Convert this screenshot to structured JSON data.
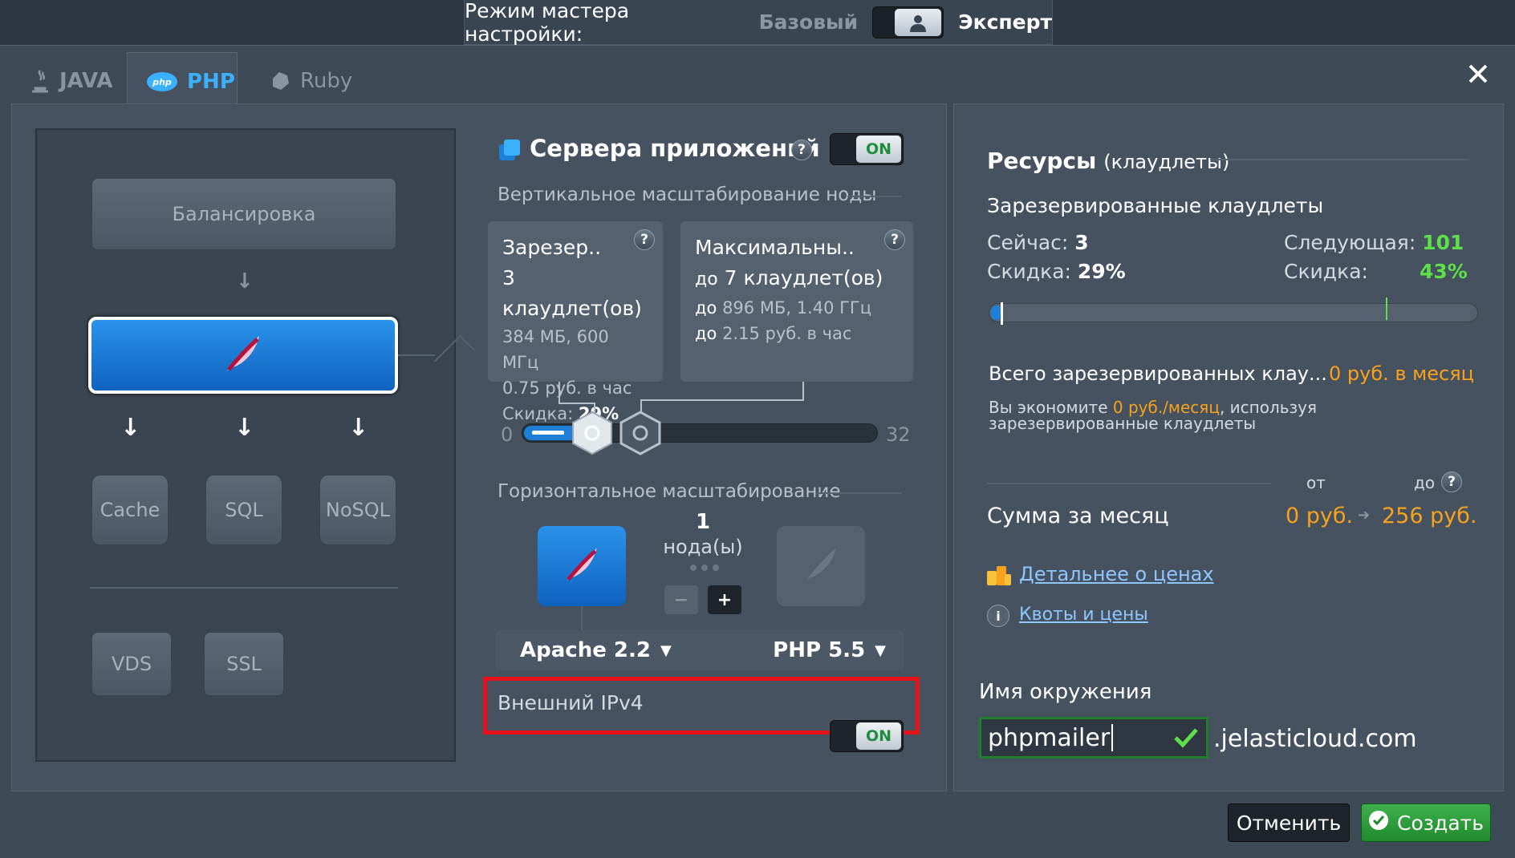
{
  "mode_bar": {
    "label": "Режим мастера настройки:",
    "basic": "Базовый",
    "expert": "Эксперт"
  },
  "tabs": [
    {
      "label": "JAVA",
      "icon": "java-icon"
    },
    {
      "label": "PHP",
      "icon": "php-icon"
    },
    {
      "label": "Ruby",
      "icon": "ruby-icon"
    }
  ],
  "active_tab": "PHP",
  "topology": {
    "balancer": "Балансировка",
    "cache": "Cache",
    "sql": "SQL",
    "nosql": "NoSQL",
    "vds": "VDS",
    "ssl": "SSL"
  },
  "app_servers": {
    "title": "Сервера приложений",
    "toggle": "ON",
    "vertical_title": "Вертикальное масштабирование ноды",
    "reserved": {
      "title": "Зарезер..",
      "value": "3 клаудлет(ов)",
      "spec": "384 МБ, 600 МГц",
      "price": "0.75 руб. в час",
      "discount_label": "Скидка:",
      "discount": "29%"
    },
    "max": {
      "title": "Максимальны..",
      "prefix": "до",
      "value": "7 клаудлет(ов)",
      "spec_prefix": "до",
      "spec": "896 МБ, 1.40 ГГц",
      "price_prefix": "до",
      "price": "2.15 руб. в час"
    },
    "slider": {
      "min": "0",
      "max": "32",
      "reserved": 3,
      "limit": 7
    },
    "horizontal_title": "Горизонтальное масштабирование",
    "nodes_count": "1",
    "nodes_label": "нода(ы)",
    "server": "Apache 2.2",
    "php": "PHP 5.5",
    "ipv4_label": "Внешний IPv4",
    "ipv4_toggle": "ON"
  },
  "resources": {
    "title": "Ресурсы",
    "title_suffix": "(клаудлеты)",
    "reserved_title": "Зарезервированные клаудлеты",
    "now_label": "Сейчас:",
    "now": "3",
    "next_label": "Следующая:",
    "next": "101",
    "discount_label": "Скидка:",
    "discount": "29%",
    "next_discount_label": "Скидка:",
    "next_discount": "43%",
    "total_label": "Всего зарезервированных клау...",
    "total_value": "0 руб. в месяц",
    "save_pre": "Вы экономите",
    "save_value": "0 руб./месяц",
    "save_post": ", используя",
    "save_line2": "зарезервированные клаудлеты",
    "from": "от",
    "to": "до",
    "month_label": "Сумма за месяц",
    "month_from": "0 руб.",
    "month_to": "256 руб.",
    "details_link": "Детальнее о ценах",
    "quotas_link": "Квоты и цены",
    "env_label": "Имя окружения",
    "env_value": "phpmailer",
    "domain": ".jelasticloud.com"
  },
  "buttons": {
    "cancel": "Отменить",
    "create": "Создать"
  },
  "colors": {
    "accent": "#1e7fd8",
    "orange": "#f7a21c",
    "green": "#5de04a",
    "highlight": "#e5121b"
  }
}
